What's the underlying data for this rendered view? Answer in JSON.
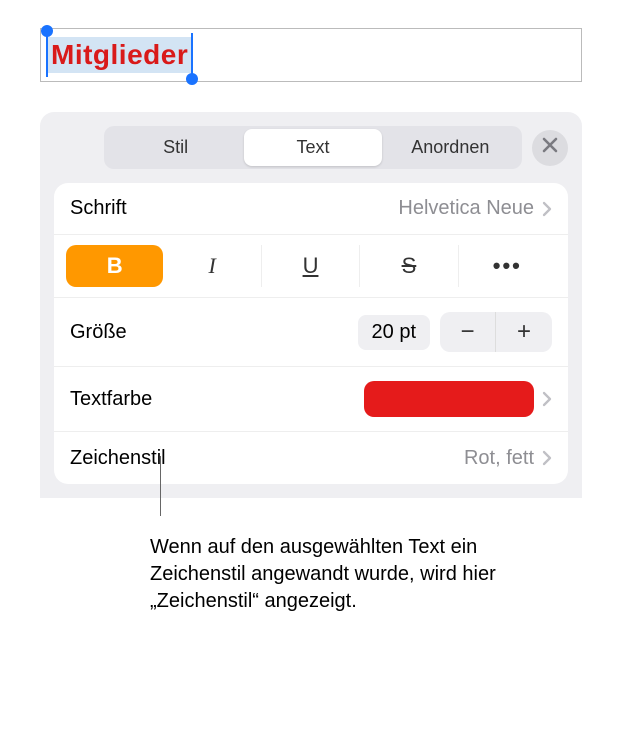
{
  "selected_text": "Mitglieder",
  "tabs": {
    "style": "Stil",
    "text": "Text",
    "arrange": "Anordnen"
  },
  "rows": {
    "font_label": "Schrift",
    "font_value": "Helvetica Neue",
    "size_label": "Größe",
    "size_value": "20 pt",
    "color_label": "Textfarbe",
    "color_value": "#e51b1b",
    "charstyle_label": "Zeichenstil",
    "charstyle_value": "Rot, fett"
  },
  "style_buttons": {
    "bold": "B",
    "italic": "I",
    "underline": "U",
    "strike": "S",
    "more": "•••"
  },
  "stepper": {
    "minus": "−",
    "plus": "+"
  },
  "callout": "Wenn auf den ausgewählten Text ein Zeichenstil angewandt wurde, wird hier „Zeichenstil“ angezeigt."
}
